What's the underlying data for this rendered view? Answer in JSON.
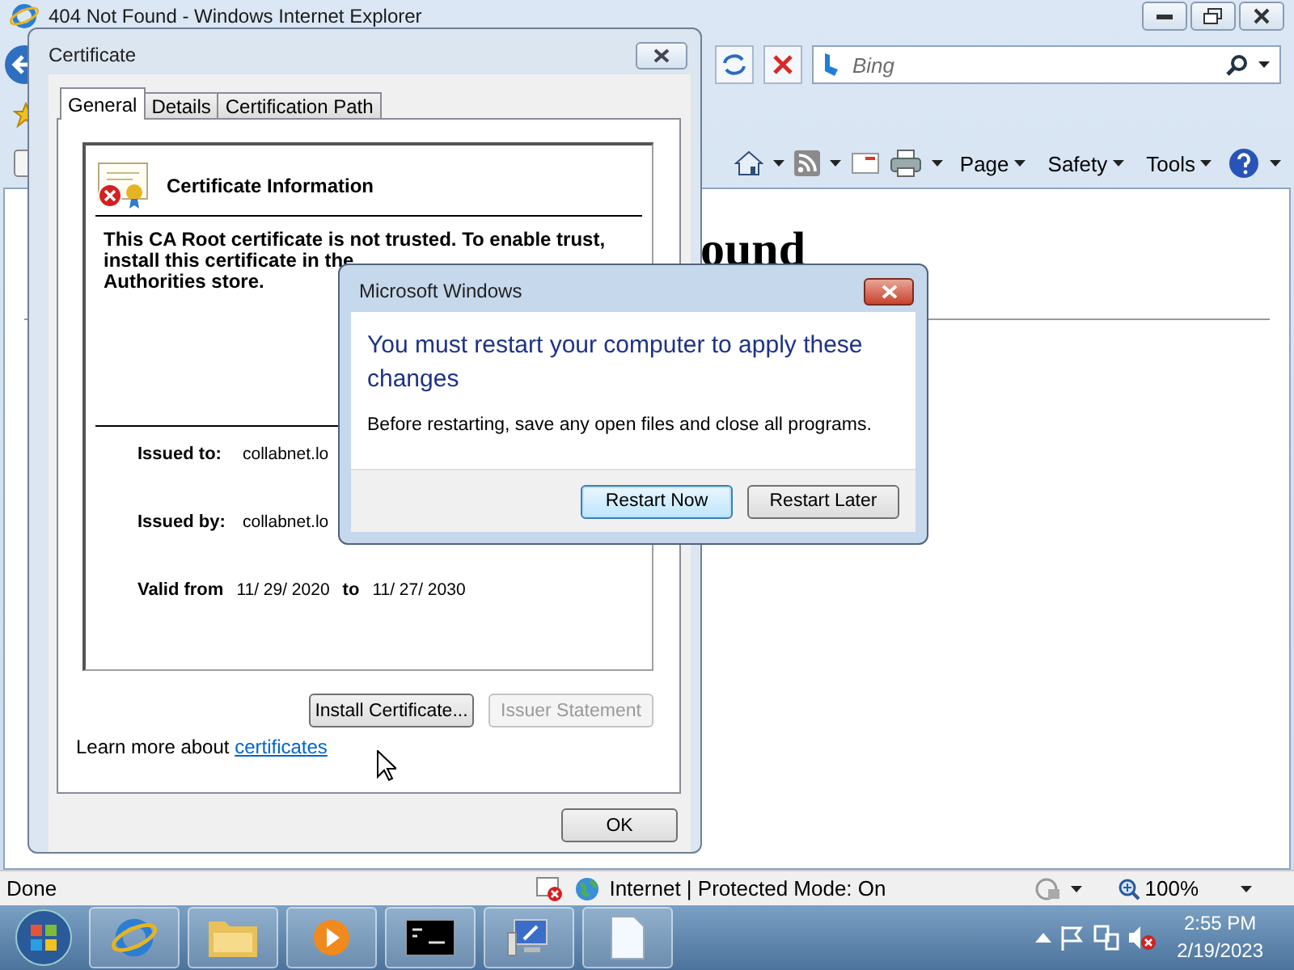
{
  "browser": {
    "title": "404 Not Found - Windows Internet Explorer",
    "search": {
      "placeholder": "Bing"
    },
    "command_bar": [
      {
        "label": "Page"
      },
      {
        "label": "Safety"
      },
      {
        "label": "Tools"
      }
    ],
    "page_heading": "ound",
    "status_bar": {
      "text": "Done",
      "zone": "Internet | Protected Mode: On",
      "zoom": "100%"
    }
  },
  "certificate_dialog": {
    "title": "Certificate",
    "tabs": [
      {
        "label": "General",
        "selected": true
      },
      {
        "label": "Details",
        "selected": false
      },
      {
        "label": "Certification Path",
        "selected": false
      }
    ],
    "heading": "Certificate Information",
    "warning": [
      "This CA Root certificate is not trusted. To enable trust,",
      "install this certificate in the",
      "Authorities store."
    ],
    "fields": [
      {
        "label": "Issued to:",
        "value": "collabnet.lo"
      },
      {
        "label": "Issued by:",
        "value": "collabnet.lo"
      }
    ],
    "valid": {
      "label": "Valid from",
      "from": "11/ 29/ 2020",
      "to_label": "to",
      "to": "11/ 27/ 2030"
    },
    "buttons": [
      {
        "label": "Install Certificate...",
        "disabled": false
      },
      {
        "label": "Issuer Statement",
        "disabled": true
      }
    ],
    "learn_more": {
      "text": "Learn more about",
      "link": "certificates"
    },
    "ok": "OK"
  },
  "message_box": {
    "title": "Microsoft Windows",
    "heading": "You must restart your computer to apply these changes",
    "text": "Before restarting, save any open files and close all programs.",
    "buttons": [
      {
        "label": "Restart Now",
        "default": true
      },
      {
        "label": "Restart Later",
        "default": false
      }
    ]
  },
  "taskbar": {
    "time": "2:55 PM",
    "date": "2/19/2023"
  }
}
